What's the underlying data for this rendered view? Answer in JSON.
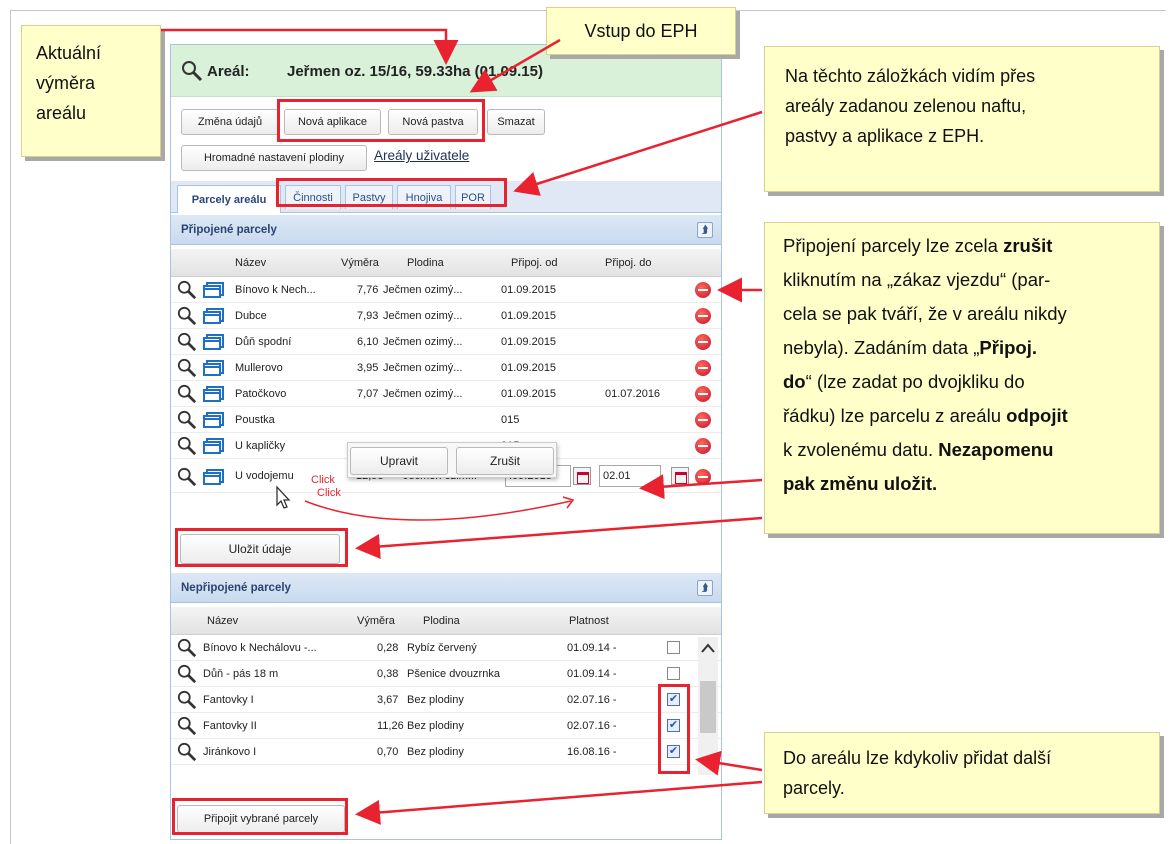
{
  "areal": {
    "label": "Areál:",
    "value": "Jeřmen oz. 15/16, 59.33ha (01.09.15)"
  },
  "toolbar": {
    "zmena": "Změna údajů",
    "nova_aplikace": "Nová aplikace",
    "nova_pastva": "Nová pastva",
    "smazat": "Smazat",
    "hromadne": "Hromadné nastavení plodiny",
    "arealy_uzivatele": "Areály uživatele"
  },
  "tabs": [
    "Parcely areálu",
    "Činnosti",
    "Pastvy",
    "Hnojiva",
    "POR"
  ],
  "pripojene": {
    "title": "Připojené parcely",
    "headers": {
      "nazev": "Název",
      "vymera": "Výměra",
      "plodina": "Plodina",
      "od": "Připoj. od",
      "do": "Připoj. do"
    },
    "rows": [
      {
        "nazev": "Bínovo k Nech...",
        "vymera": "7,76",
        "plodina": "Ječmen ozimý...",
        "od": "01.09.2015",
        "do": ""
      },
      {
        "nazev": "Dubce",
        "vymera": "7,93",
        "plodina": "Ječmen ozimý...",
        "od": "01.09.2015",
        "do": ""
      },
      {
        "nazev": "Důň spodní",
        "vymera": "6,10",
        "plodina": "Ječmen ozimý...",
        "od": "01.09.2015",
        "do": ""
      },
      {
        "nazev": "Mullerovo",
        "vymera": "3,95",
        "plodina": "Ječmen ozimý...",
        "od": "01.09.2015",
        "do": ""
      },
      {
        "nazev": "Patočkovo",
        "vymera": "7,07",
        "plodina": "Ječmen ozimý...",
        "od": "01.09.2015",
        "do": "01.07.2016"
      },
      {
        "nazev": "Poustka",
        "vymera": "",
        "plodina": "",
        "od": "015",
        "do": ""
      },
      {
        "nazev": "U kapličky",
        "vymera": "",
        "plodina": "",
        "od": "015",
        "do": ""
      }
    ],
    "edit_row": {
      "nazev": "U vodojemu",
      "vymera": "12,98",
      "plodina": "Ječmen ozim...",
      "od": ".09.2015",
      "do": "02.01"
    },
    "popup": {
      "upravit": "Upravit",
      "zrusit": "Zrušit"
    },
    "click_label": "Click",
    "click_label2": "Click",
    "ulozit": "Uložit údaje"
  },
  "nepripojene": {
    "title": "Nepřipojené parcely",
    "headers": {
      "nazev": "Název",
      "vymera": "Výměra",
      "plodina": "Plodina",
      "platnost": "Platnost"
    },
    "rows": [
      {
        "nazev": "Bínovo k Nechálovu -...",
        "vymera": "0,28",
        "plodina": "Rybíz červený",
        "platnost": "01.09.14 -",
        "checked": false
      },
      {
        "nazev": "Důň - pás 18 m",
        "vymera": "0,38",
        "plodina": "Pšenice dvouzrnka",
        "platnost": "01.09.14 -",
        "checked": false
      },
      {
        "nazev": "Fantovky I",
        "vymera": "3,67",
        "plodina": "Bez plodiny",
        "platnost": "02.07.16 -",
        "checked": true
      },
      {
        "nazev": "Fantovky II",
        "vymera": "11,26",
        "plodina": "Bez plodiny",
        "platnost": "02.07.16 -",
        "checked": true
      },
      {
        "nazev": "Jiránkovo I",
        "vymera": "0,70",
        "plodina": "Bez plodiny",
        "platnost": "16.08.16 -",
        "checked": true
      }
    ],
    "pripojit": "Připojit vybrané parcely"
  },
  "notes": {
    "aktualni": [
      "Aktuální",
      "výměra",
      "areálu"
    ],
    "vstup": "Vstup do EPH",
    "zalozky": [
      "Na těchto záložkách vidím přes",
      "areály zadanou zelenou naftu,",
      "pastvy a aplikace z EPH."
    ],
    "pripojeni": {
      "l1a": "Připojení parcely lze zcela ",
      "l1b": "zrušit",
      "l2": "kliknutím na „zákaz vjezdu“ (par-",
      "l3": "cela se pak tváří, že v areálu nikdy",
      "l4a": "nebyla). Zadáním data „",
      "l4b": "Připoj.",
      "l5a": "do",
      "l5b": "“ (lze zadat po dvojkliku do",
      "l6a": "řádku) lze parcelu z areálu ",
      "l6b": "odpojit",
      "l7a": "k zvolenému datu. ",
      "l7b": "Nezapomenu",
      "l8": "pak změnu uložit."
    },
    "pridat": [
      "Do areálu lze kdykoliv přidat další",
      "parcely."
    ]
  }
}
